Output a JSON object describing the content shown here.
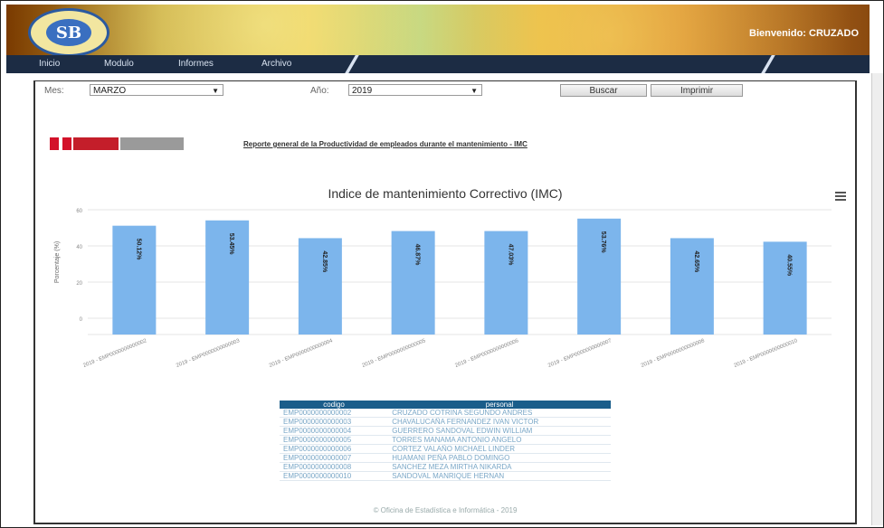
{
  "header": {
    "logo_text": "SB",
    "welcome": "Bienvenido: CRUZADO"
  },
  "nav": {
    "items": [
      {
        "label": "Inicio"
      },
      {
        "label": "Modulo"
      },
      {
        "label": "Informes"
      },
      {
        "label": "Archivo"
      }
    ]
  },
  "filters": {
    "month_label": "Mes:",
    "month_value": "MARZO",
    "year_label": "Año:",
    "year_value": "2019",
    "search_button": "Buscar",
    "print_button": "Imprimir"
  },
  "report": {
    "title": "Reporte general de la Productividad de empleados durante el mantenimiento - IMC"
  },
  "chart_data": {
    "type": "bar",
    "title": "Indice de mantenimiento Correctivo (IMC)",
    "ylabel": "Porcentaje (%)",
    "ylim": [
      0,
      60
    ],
    "yticks": [
      "60",
      "40",
      "20",
      "0",
      ""
    ],
    "categories": [
      "2019 - EMP0000000000002",
      "2019 - EMP0000000000003",
      "2019 - EMP0000000000004",
      "2019 - EMP0000000000005",
      "2019 - EMP0000000000006",
      "2019 - EMP0000000000007",
      "2019 - EMP0000000000008",
      "2019 - EMP0000000000010"
    ],
    "values": [
      50,
      53,
      43,
      47,
      47,
      54,
      43,
      41
    ],
    "data_labels": [
      "50.12%",
      "53.45%",
      "42.85%",
      "46.87%",
      "47.03%",
      "53.76%",
      "42.65%",
      "40.55%"
    ],
    "bar_color": "#7cb5ec",
    "grid": true,
    "legend": "none"
  },
  "table": {
    "headers": [
      "codigo",
      "personal"
    ],
    "rows": [
      [
        "EMP0000000000002",
        "CRUZADO COTRINA SEGUNDO ANDRES"
      ],
      [
        "EMP0000000000003",
        "CHAVALUCAÑA FERNANDEZ IVAN VICTOR"
      ],
      [
        "EMP0000000000004",
        "GUERRERO SANDOVAL EDWIN WILLIAM"
      ],
      [
        "EMP0000000000005",
        "TORRES MANAMA ANTONIO ANGELO"
      ],
      [
        "EMP0000000000006",
        "CORTEZ VALAÑO MICHAEL LINDER"
      ],
      [
        "EMP0000000000007",
        "HUAMANI PEÑA PABLO DOMINGO"
      ],
      [
        "EMP0000000000008",
        "SANCHEZ MEZA MIRTHA NIKARDA"
      ],
      [
        "EMP0000000000010",
        "SANDOVAL MANRIQUE HERNAN"
      ]
    ]
  },
  "footer": {
    "text": "© Oficina de Estadística e Informática - 2019"
  }
}
